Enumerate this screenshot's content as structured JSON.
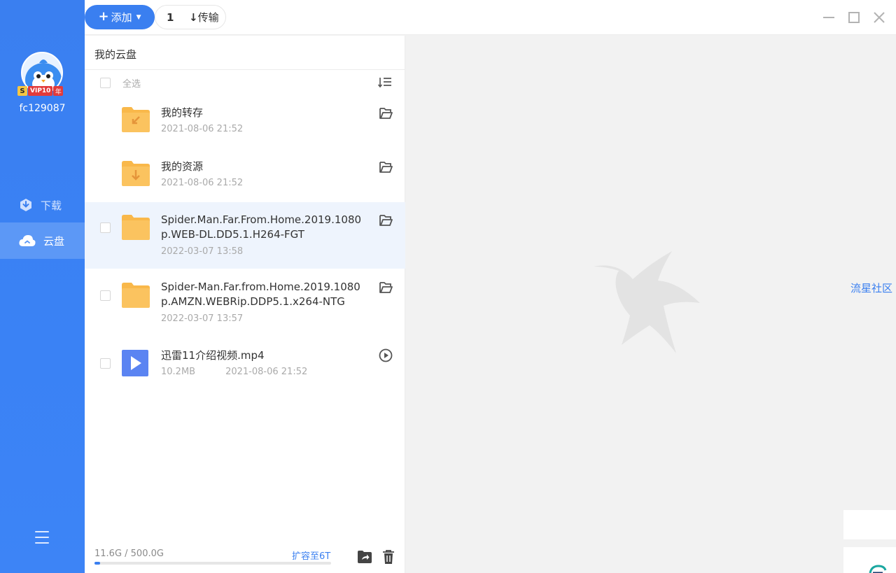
{
  "sidebar": {
    "username": "fc129087",
    "vip_badge": {
      "s": "S",
      "vip": "VIP10",
      "year": "年"
    },
    "nav": [
      {
        "label": "下载",
        "icon": "download-icon"
      },
      {
        "label": "云盘",
        "icon": "cloud-icon"
      }
    ]
  },
  "toolbar": {
    "add_label": "添加",
    "transfer_count": "1",
    "transfer_label": "传输"
  },
  "panel": {
    "title": "我的云盘",
    "select_all": "全选",
    "files": [
      {
        "name": "我的转存",
        "date": "2021-08-06 21:52",
        "size": "",
        "type": "folder-transfer",
        "action": "open-folder-icon"
      },
      {
        "name": "我的资源",
        "date": "2021-08-06 21:52",
        "size": "",
        "type": "folder-download",
        "action": "open-folder-icon"
      },
      {
        "name": "Spider.Man.Far.From.Home.2019.1080p.WEB-DL.DD5.1.H264-FGT",
        "date": "2022-03-07 13:58",
        "size": "",
        "type": "folder",
        "action": "open-folder-icon"
      },
      {
        "name": "Spider-Man.Far.from.Home.2019.1080p.AMZN.WEBRip.DDP5.1.x264-NTG",
        "date": "2022-03-07 13:57",
        "size": "",
        "type": "folder",
        "action": "open-folder-icon"
      },
      {
        "name": "迅雷11介绍视频.mp4",
        "date": "2021-08-06 21:52",
        "size": "10.2MB",
        "type": "video",
        "action": "play-icon"
      }
    ],
    "usage": "11.6G / 500.0G",
    "usage_fraction": 0.023,
    "expand_label": "扩容至6T"
  },
  "right_panel": {
    "community_link": "流星社区"
  },
  "colors": {
    "accent": "#3a7ff0",
    "folder": "#f9b84a",
    "video": "#5b84f2"
  }
}
